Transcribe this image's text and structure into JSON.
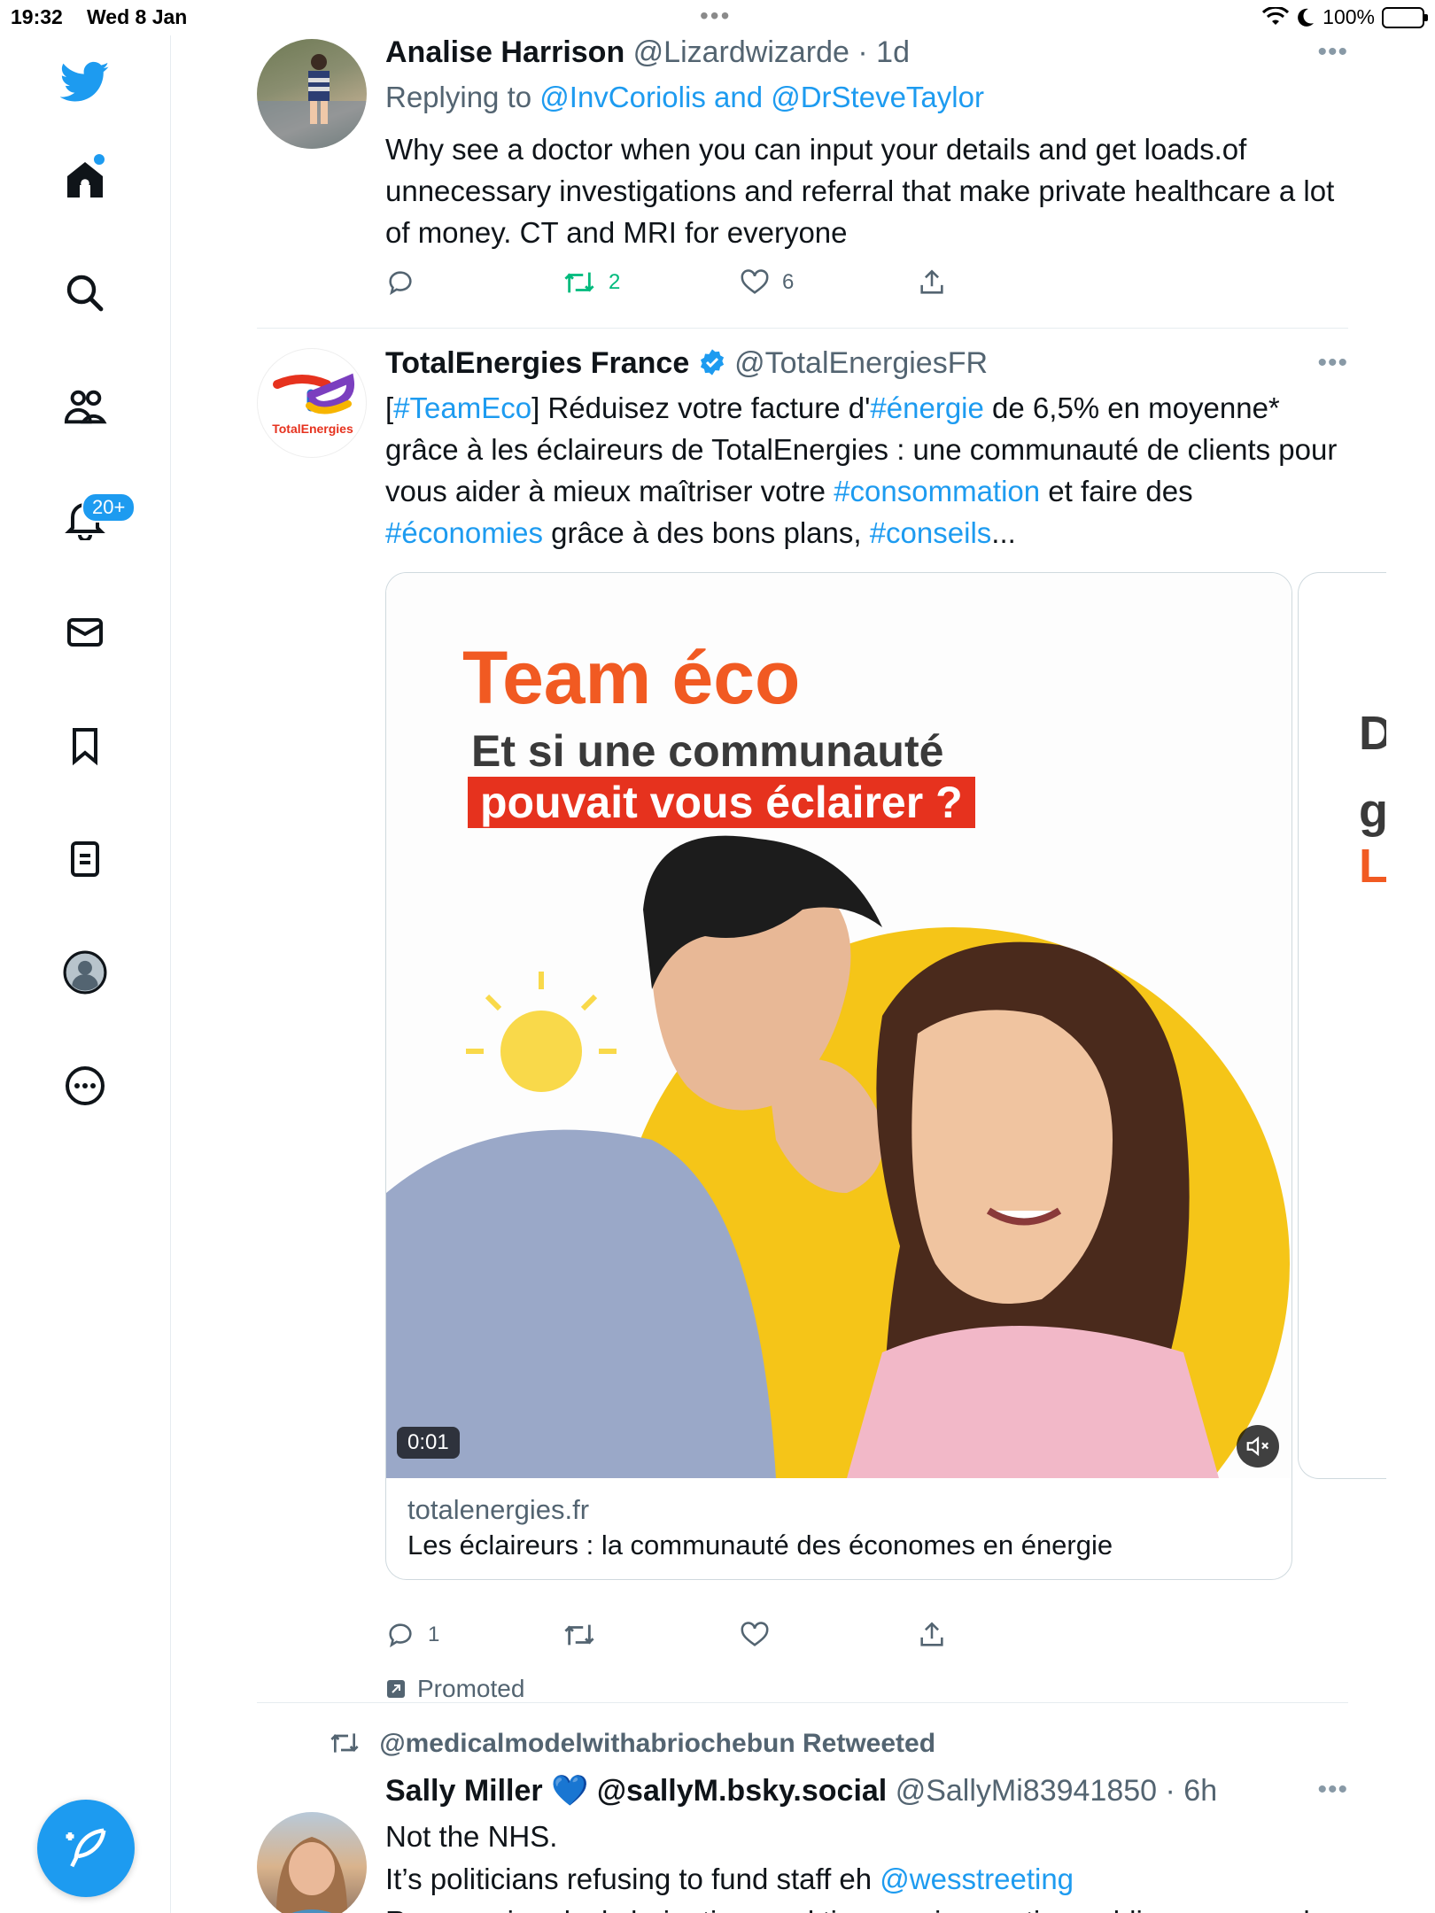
{
  "status_bar": {
    "time": "19:32",
    "date": "Wed 8 Jan",
    "dots": "•••",
    "battery": "100%"
  },
  "nav": {
    "notifications_badge": "20+",
    "accent": "#1d9bf0"
  },
  "tweets": [
    {
      "name": "Analise Harrison",
      "handle": "@Lizardwizarde",
      "time": "· 1d",
      "reply_prefix": "Replying to",
      "reply_to": "@InvCoriolis and @DrSteveTaylor",
      "text": "Why see a doctor when you can input your details and get loads.of unnecessary investigations and referral that make private healthcare a lot of money. CT and MRI for everyone",
      "retweets": "2",
      "likes": "6"
    },
    {
      "name": "TotalEnergies France",
      "handle": "@TotalEnergiesFR",
      "avatar_text": "TotalEnergies",
      "text_parts": {
        "p1": "[",
        "h1": "#TeamEco",
        "p2": "] Réduisez votre facture d'",
        "h2": "#énergie",
        "p3": " de 6,5% en moyenne* grâce à les éclaireurs de TotalEnergies : une communauté de clients pour vous aider à mieux maîtriser votre ",
        "h3": "#consommation",
        "p4": " et faire des ",
        "h4": "#économies",
        "p5": " grâce à des bons plans, ",
        "h5": "#conseils",
        "p6": "..."
      },
      "card": {
        "headline": "Team éco",
        "line1": "Et si une communauté",
        "line2": "pouvait vous éclairer ?",
        "duration": "0:01",
        "domain": "totalenergies.fr",
        "title": "Les éclaireurs : la communauté des économes en énergie"
      },
      "next_card_glyphs": {
        "l1": "D",
        "l2": "g",
        "l3": "L"
      },
      "replies": "1",
      "promoted_label": "Promoted"
    },
    {
      "retweeted_by": "@medicalmodelwithabriochebun Retweeted",
      "name": "Sally Miller",
      "heart_emoji": "💙",
      "alt_handle": "@sallyM.bsky.social",
      "handle": "@SallyMi83941850",
      "time": "· 6h",
      "line1": "Not the NHS.",
      "line2_prefix": "It’s politicians refusing to fund staff eh ",
      "line2_mention": "@wesstreeting",
      "line3": "Rearranging deckchairs time and time again, wasting public money and"
    }
  ]
}
